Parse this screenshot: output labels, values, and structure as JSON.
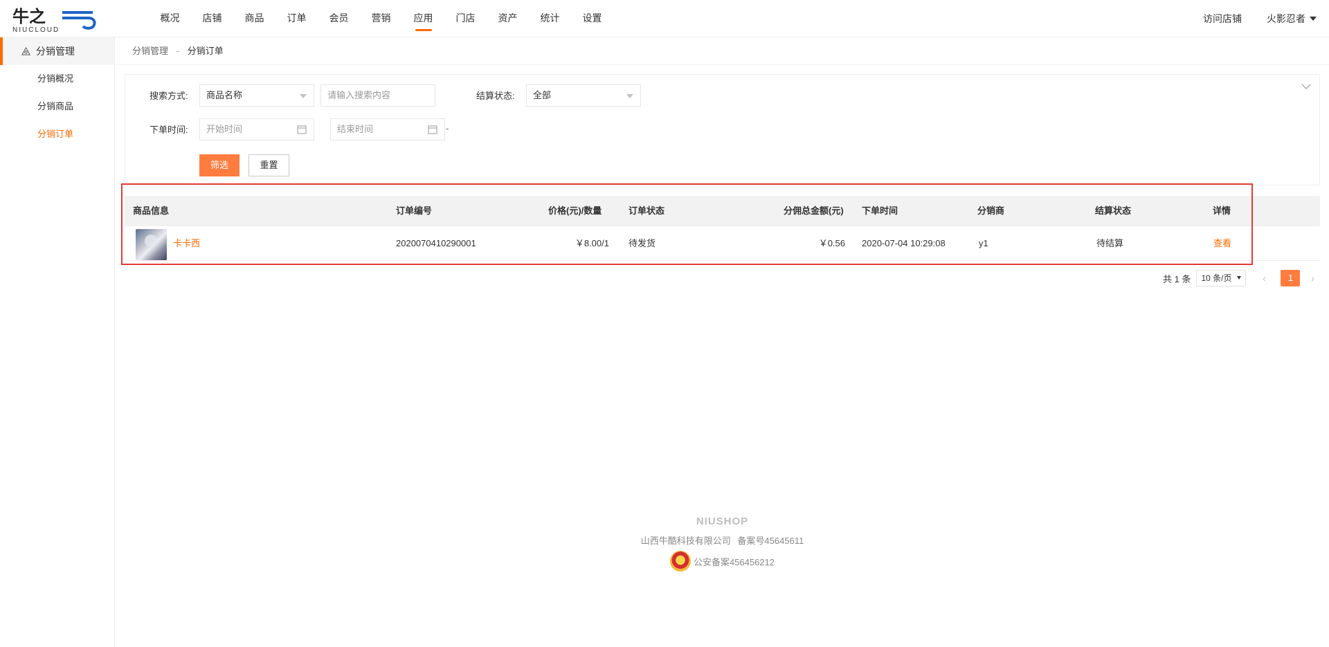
{
  "header": {
    "logo_text": "牛之云",
    "logo_sub": "NIUCLOUD",
    "nav": [
      {
        "label": "概况"
      },
      {
        "label": "店铺"
      },
      {
        "label": "商品"
      },
      {
        "label": "订单"
      },
      {
        "label": "会员"
      },
      {
        "label": "营销"
      },
      {
        "label": "应用"
      },
      {
        "label": "门店"
      },
      {
        "label": "资产"
      },
      {
        "label": "统计"
      },
      {
        "label": "设置"
      }
    ],
    "active_nav": "应用",
    "visit_store": "访问店铺",
    "user": "火影忍者"
  },
  "sidebar": {
    "group": "分销管理",
    "items": [
      {
        "label": "分销概况"
      },
      {
        "label": "分销商品"
      },
      {
        "label": "分销订单"
      }
    ],
    "active_item": "分销订单"
  },
  "breadcrumb": {
    "parent": "分销管理",
    "separator": "-",
    "current": "分销订单"
  },
  "filter": {
    "search_mode_label": "搜索方式:",
    "search_mode_value": "商品名称",
    "search_placeholder": "请输入搜索内容",
    "settle_label": "结算状态:",
    "settle_value": "全部",
    "time_label": "下单时间:",
    "start_placeholder": "开始时间",
    "end_placeholder": "结束时间",
    "range_dash": "-",
    "filter_button": "筛选",
    "reset_button": "重置"
  },
  "table": {
    "columns": [
      "商品信息",
      "订单编号",
      "价格(元)/数量",
      "订单状态",
      "分佣总金额(元)",
      "下单时间",
      "分销商",
      "结算状态",
      "详情"
    ],
    "rows": [
      {
        "goods_name": "卡卡西",
        "order_no": "2020070410290001",
        "price_qty": "￥8.00/1",
        "order_status": "待发货",
        "commission": "￥0.56",
        "order_time": "2020-07-04 10:29:08",
        "distributor": "y1",
        "settle_status": "待结算",
        "detail": "查看"
      }
    ]
  },
  "pagination": {
    "total": "共 1 条",
    "page_size": "10 条/页",
    "current_page": "1",
    "prev": "‹",
    "next": "›"
  },
  "footer": {
    "brand": "NIUSHOP",
    "company": "山西牛酷科技有限公司",
    "icp": "备案号45645611",
    "police": "公安备案456456212"
  },
  "colors": {
    "accent": "#ff6a00",
    "button": "#ff7c3f",
    "highlight_border": "#e53935"
  }
}
